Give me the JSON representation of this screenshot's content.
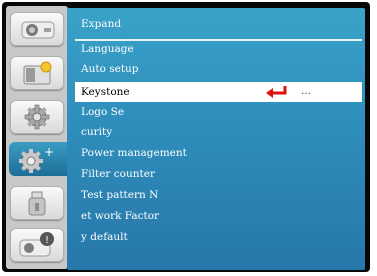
{
  "sidebar": {
    "tabs": [
      {
        "name": "picture-icon"
      },
      {
        "name": "image-adjust-icon"
      },
      {
        "name": "settings-gear-icon"
      },
      {
        "name": "expand-gear-icon"
      },
      {
        "name": "usb-icon"
      },
      {
        "name": "info-icon"
      }
    ]
  },
  "menu": {
    "items": [
      "Expand",
      "Language",
      "Auto setup",
      "Keystone",
      "Logo  Se",
      "curity",
      "Power management",
      "Filter counter",
      "Test pattern   N",
      "et work   Factor",
      "y default"
    ],
    "selected_suffix": "…",
    "enter_icon": "enter-arrow-icon",
    "colors": {
      "panel": "#3092be",
      "selection": "#ffffff",
      "enter_arrow": "#e01010",
      "active_tab": "#2a86b3"
    }
  }
}
